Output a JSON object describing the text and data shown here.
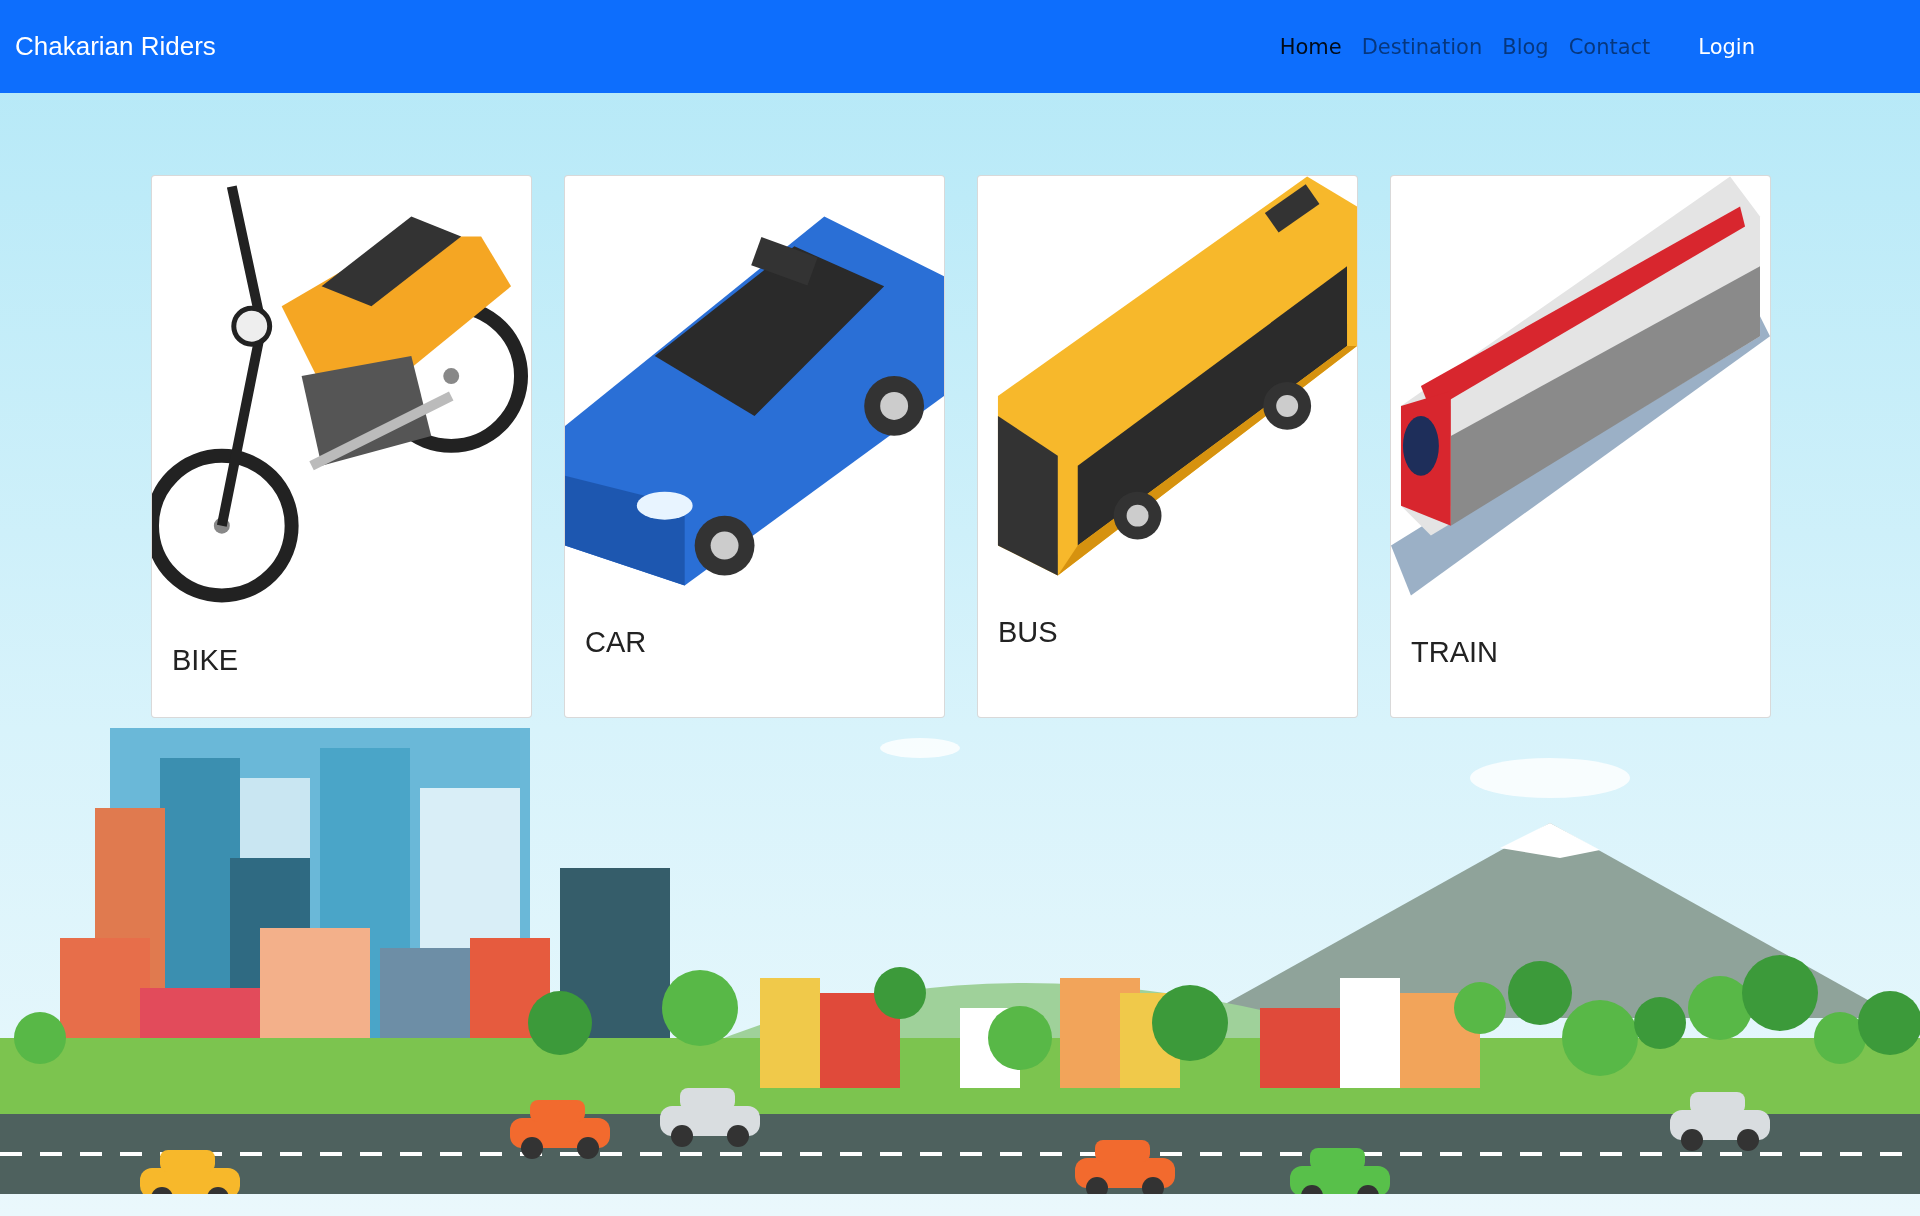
{
  "navbar": {
    "brand": "Chakarian Riders",
    "links": [
      {
        "label": "Home",
        "selected": true
      },
      {
        "label": "Destination",
        "selected": false
      },
      {
        "label": "Blog",
        "selected": false
      },
      {
        "label": "Contact",
        "selected": false
      }
    ],
    "login": "Login"
  },
  "cards": [
    {
      "kind": "bike",
      "label": "BIKE"
    },
    {
      "kind": "car",
      "label": "CAR"
    },
    {
      "kind": "bus",
      "label": "BUS"
    },
    {
      "kind": "train",
      "label": "TRAIN"
    }
  ]
}
